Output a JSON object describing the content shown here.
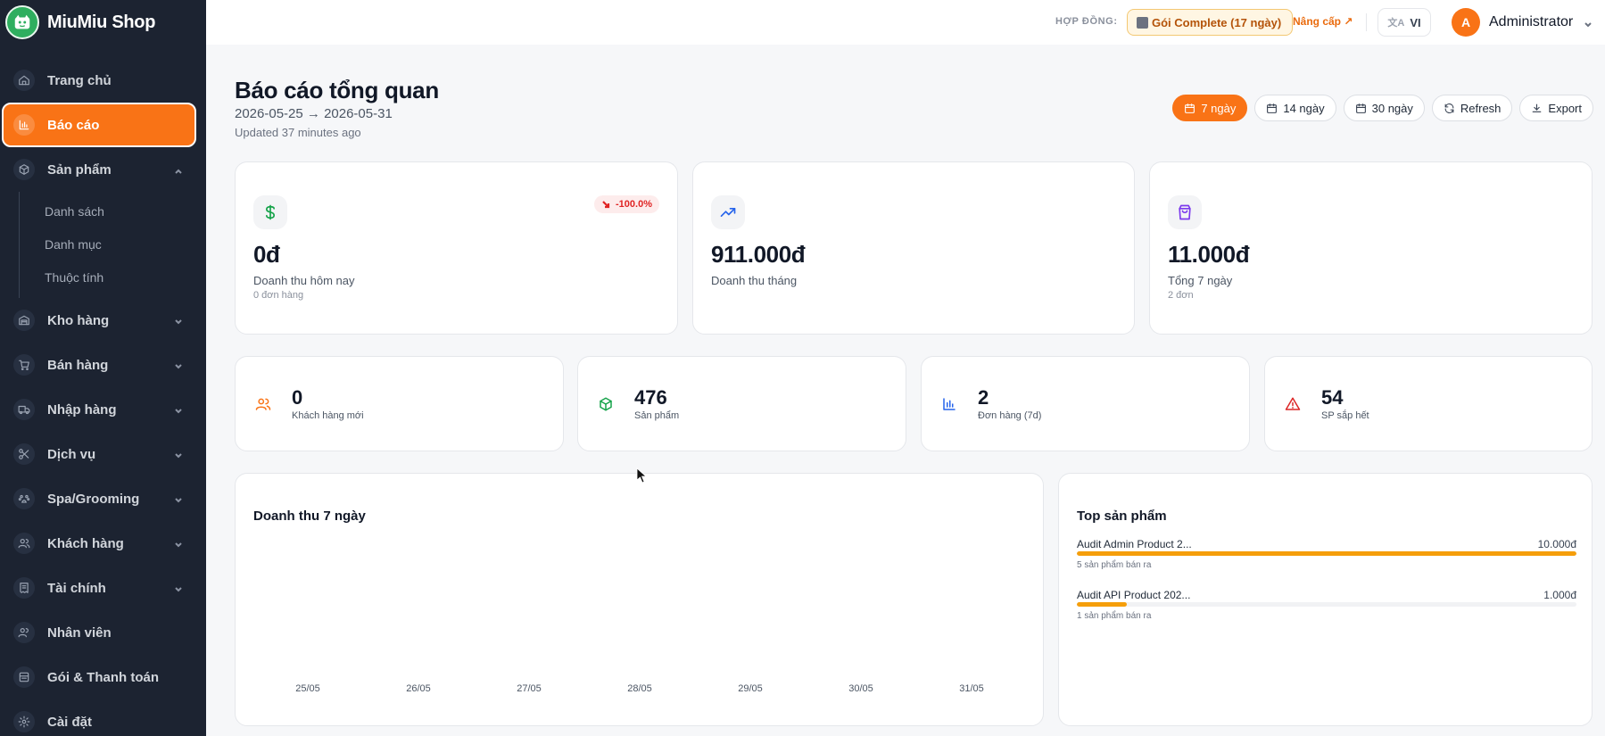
{
  "brand": {
    "name": "MiuMiu Shop"
  },
  "sidebar": {
    "items": [
      {
        "label": "Trang chủ",
        "icon": "home-icon"
      },
      {
        "label": "Báo cáo",
        "icon": "bar-chart-icon",
        "active": true
      },
      {
        "label": "Sản phẩm",
        "icon": "box-icon",
        "expanded": true
      },
      {
        "label": "Kho hàng",
        "icon": "warehouse-icon"
      },
      {
        "label": "Bán hàng",
        "icon": "cart-icon"
      },
      {
        "label": "Nhập hàng",
        "icon": "truck-icon"
      },
      {
        "label": "Dịch vụ",
        "icon": "scissors-icon"
      },
      {
        "label": "Spa/Grooming",
        "icon": "paw-icon"
      },
      {
        "label": "Khách hàng",
        "icon": "users-icon"
      },
      {
        "label": "Tài chính",
        "icon": "receipt-icon"
      },
      {
        "label": "Nhân viên",
        "icon": "staff-icon"
      },
      {
        "label": "Gói & Thanh toán",
        "icon": "package-icon"
      },
      {
        "label": "Cài đặt",
        "icon": "gear-icon"
      }
    ],
    "product_sub": [
      "Danh sách",
      "Danh mục",
      "Thuộc tính"
    ]
  },
  "header": {
    "contract_label": "HỢP ĐỒNG:",
    "plan": "Gói Complete (17 ngày)",
    "upgrade": "Nâng cấp ↗",
    "language": "VI",
    "avatar_initial": "A",
    "user": "Administrator"
  },
  "page": {
    "title": "Báo cáo tổng quan",
    "range": "2026-05-25 → 2026-05-31",
    "updated": "Updated 37 minutes ago",
    "range_buttons": [
      "7 ngày",
      "14 ngày",
      "30 ngày"
    ],
    "refresh": "Refresh",
    "export": "Export"
  },
  "stats_top": [
    {
      "value": "0đ",
      "label": "Doanh thu hôm nay",
      "sub": "0 đơn hàng",
      "delta": "-100.0%"
    },
    {
      "value": "911.000đ",
      "label": "Doanh thu tháng",
      "sub": ""
    },
    {
      "value": "11.000đ",
      "label": "Tổng 7 ngày",
      "sub": "2 đơn"
    }
  ],
  "stats_small": [
    {
      "value": "0",
      "label": "Khách hàng mới"
    },
    {
      "value": "476",
      "label": "Sản phẩm"
    },
    {
      "value": "2",
      "label": "Đơn hàng (7d)"
    },
    {
      "value": "54",
      "label": "SP sắp hết"
    }
  ],
  "chart_title": "Doanh thu 7 ngày",
  "chart_data": {
    "type": "bar",
    "title": "Doanh thu 7 ngày",
    "categories": [
      "25/05",
      "26/05",
      "27/05",
      "28/05",
      "29/05",
      "30/05",
      "31/05"
    ],
    "xlabel": "",
    "ylabel": ""
  },
  "top_products": {
    "title": "Top sản phẩm",
    "items": [
      {
        "name": "Audit Admin Product 2...",
        "value": "10.000đ",
        "sub": "5 sản phẩm bán ra",
        "share": 1.0
      },
      {
        "name": "Audit API Product 202...",
        "value": "1.000đ",
        "sub": "1 sản phẩm bán ra",
        "share": 0.1
      }
    ]
  },
  "colors": {
    "accent": "#f97316",
    "sidebar_bg": "#1c2331",
    "bar": "#f59e0b"
  }
}
